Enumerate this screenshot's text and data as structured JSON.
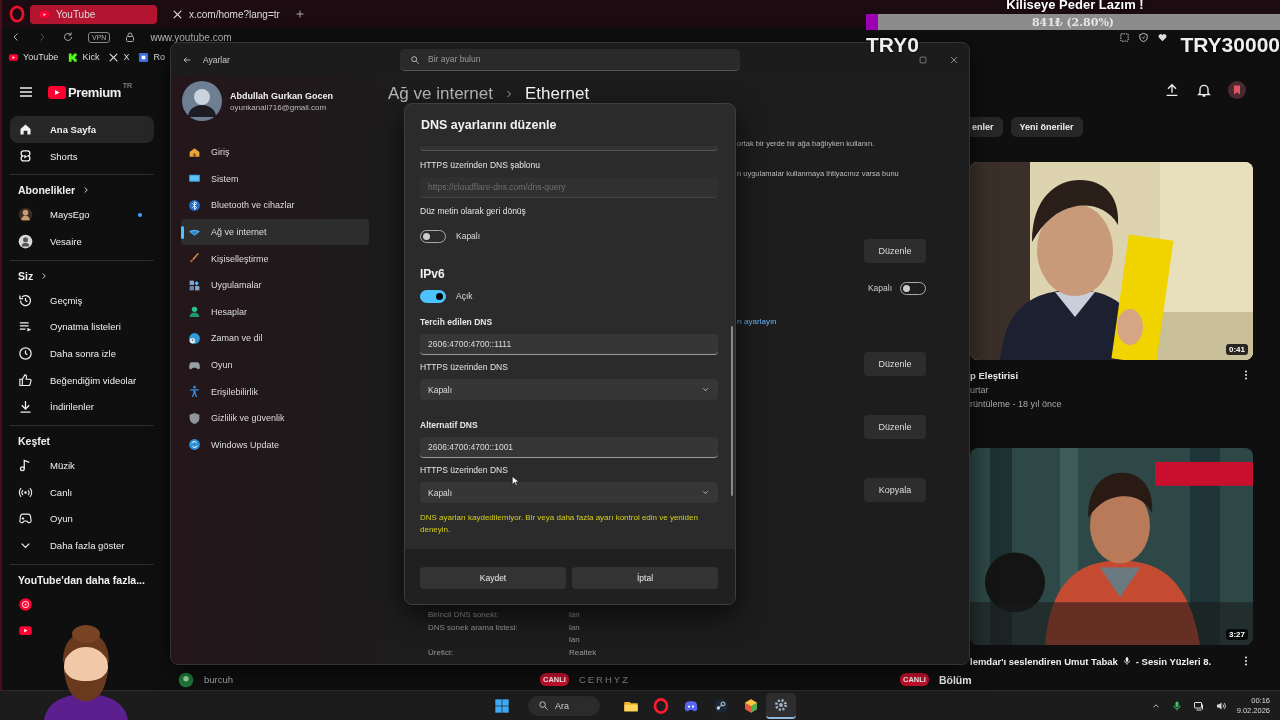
{
  "browser": {
    "tabs": [
      {
        "label": "YouTube",
        "selected": true
      },
      {
        "label": "x.com/home?lang=tr",
        "selected": false
      }
    ],
    "vpn": "VPN",
    "url": "www.youtube.com",
    "bookmarks": [
      "YouTube",
      "Kick",
      "X",
      "Ro"
    ]
  },
  "youtube": {
    "logo": "Premium",
    "region": "TR",
    "sidebar": [
      {
        "items": [
          {
            "label": "Ana Sayfa",
            "selected": true
          },
          {
            "label": "Shorts",
            "selected": false
          }
        ]
      },
      {
        "heading": "Abonelikler",
        "more": true,
        "items": [
          {
            "label": "MaysEgo",
            "selected": false,
            "new_content": true
          },
          {
            "label": "Vesaire",
            "selected": false,
            "new_content": false
          }
        ]
      },
      {
        "heading": "Siz",
        "more": true,
        "items": [
          {
            "label": "Geçmiş",
            "selected": false
          },
          {
            "label": "Oynatma listeleri",
            "selected": false
          },
          {
            "label": "Daha sonra izle",
            "selected": false
          },
          {
            "label": "Beğendiğim videolar",
            "selected": false
          },
          {
            "label": "İndirilenler",
            "selected": false
          }
        ]
      },
      {
        "heading": "Keşfet",
        "more": false,
        "items": [
          {
            "label": "Müzik",
            "selected": false
          },
          {
            "label": "Canlı",
            "selected": false
          },
          {
            "label": "Oyun",
            "selected": false
          },
          {
            "label": "Daha fazla göster",
            "selected": false
          }
        ]
      },
      {
        "heading": "YouTube'dan daha fazla...",
        "more": false,
        "items": [
          {
            "selected": false
          },
          {
            "selected": false
          }
        ]
      }
    ],
    "chips": [
      "enler",
      "Yeni öneriler"
    ],
    "videos": [
      {
        "duration": "0:41",
        "title": "p Eleştirisi",
        "channel": "urtar",
        "meta": "rüntüleme - 18 yıl önce"
      },
      {
        "duration": "3:27",
        "title": "lemdar'ı seslendiren Umut Tabak",
        "title_after_icon": "- Sesin Yüzleri 8.",
        "title_line2": "Bölüm",
        "live_badge": "CANLI"
      }
    ],
    "bottom_strip": [
      {
        "name": "burcuh"
      },
      {
        "name": "CERHYZ",
        "live_badge": "CANLI"
      }
    ]
  },
  "settings": {
    "title": "Ayarlar",
    "search_placeholder": "Bir ayar bulun",
    "user": {
      "name": "Abdullah Gurkan Gocen",
      "email": "oyunkanali716@gmail.com"
    },
    "nav": [
      {
        "label": "Giriş",
        "selected": false
      },
      {
        "label": "Sistem",
        "selected": false
      },
      {
        "label": "Bluetooth ve cihazlar",
        "selected": false
      },
      {
        "label": "Ağ ve internet",
        "selected": true
      },
      {
        "label": "Kişiselleştirme",
        "selected": false
      },
      {
        "label": "Uygulamalar",
        "selected": false
      },
      {
        "label": "Hesaplar",
        "selected": false
      },
      {
        "label": "Zaman ve dil",
        "selected": false
      },
      {
        "label": "Oyun",
        "selected": false
      },
      {
        "label": "Erişilebilirlik",
        "selected": false
      },
      {
        "label": "Gizlilik ve güvenlik",
        "selected": false
      },
      {
        "label": "Windows Update",
        "selected": false
      }
    ],
    "breadcrumb": [
      "Ağ ve internet",
      "Ethernet"
    ],
    "rows": [
      {
        "kind": "note",
        "text": "ortak bir yerde bir ağa bağlıyken kullanın."
      },
      {
        "kind": "note",
        "text": "n uygulamalar kullanmaya ihtiyacınız varsa bunu"
      },
      {
        "kind": "button",
        "label": "Düzenle"
      },
      {
        "kind": "toggle",
        "label": "Kapalı",
        "on": false
      },
      {
        "kind": "link",
        "text": "rı ayarlayın"
      },
      {
        "kind": "button",
        "label": "Düzenle"
      },
      {
        "kind": "button",
        "label": "Düzenle"
      },
      {
        "kind": "button",
        "label": "Kopyala"
      }
    ],
    "details": [
      {
        "label": "Birincil DNS soneki:",
        "values": [
          "lan"
        ]
      },
      {
        "label": "DNS sonek arama listesi:",
        "values": [
          "lan",
          "lan"
        ]
      },
      {
        "label": "Üretici:",
        "values": [
          "Realtek"
        ]
      }
    ]
  },
  "dialog": {
    "title": "DNS ayarlarını düzenle",
    "fields": [
      {
        "kind": "cut-field"
      },
      {
        "kind": "input",
        "label": "HTTPS üzerinden DNS şablonu",
        "strong": false,
        "placeholder": "https://cloudflare-dns.com/dns-query"
      },
      {
        "kind": "toggle",
        "label": "Düz metin olarak geri dönüş",
        "on": false,
        "state": "Kapalı"
      },
      {
        "kind": "heading",
        "label": "IPv6"
      },
      {
        "kind": "toggle",
        "on": true,
        "state": "Açık"
      },
      {
        "kind": "input",
        "label": "Tercih edilen DNS",
        "strong": true,
        "value": "2606:4700:4700::1111"
      },
      {
        "kind": "select",
        "label": "HTTPS üzerinden DNS",
        "strong": false,
        "value": "Kapalı"
      },
      {
        "kind": "input",
        "label": "Alternatif DNS",
        "strong": true,
        "value": "2606:4700:4700::1001"
      },
      {
        "kind": "select",
        "label": "HTTPS üzerinden DNS",
        "strong": false,
        "value": "Kapalı"
      },
      {
        "kind": "error",
        "text": "DNS ayarları kaydedilemiyor. Bir veya daha fazla ayarı kontrol edin ve yeniden deneyin."
      }
    ],
    "buttons": [
      "Kaydet",
      "İptal"
    ]
  },
  "overlay": {
    "goal_title": "Kiliseye Peder Lazım !",
    "goal_amount": "841₺ (2.80%)",
    "level": 0.028,
    "goal_start": "TRY0",
    "goal_end": "TRY30000"
  },
  "taskbar": {
    "search": "Ara",
    "apps": [
      {
        "selected": false
      },
      {
        "selected": false
      },
      {
        "selected": false
      },
      {
        "selected": false
      },
      {
        "selected": false
      },
      {
        "selected": true
      }
    ],
    "time": "00:16",
    "date": "9.02.2026"
  }
}
